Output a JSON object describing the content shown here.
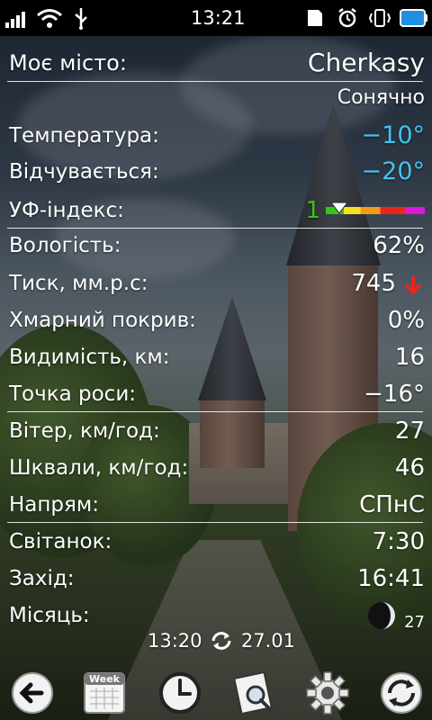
{
  "status_bar": {
    "time": "13:21",
    "icons": [
      "signal-icon",
      "wifi-icon",
      "usb-icon",
      "sd-card-icon",
      "alarm-icon",
      "vibrate-icon",
      "battery-icon"
    ]
  },
  "weather": {
    "city_label": "Моє місто:",
    "city": "Cherkasy",
    "condition": "Сонячно",
    "rows": [
      {
        "label": "Температура:",
        "value": "−10°",
        "color": "blue"
      },
      {
        "label": "Відчувається:",
        "value": "−20°",
        "color": "blue"
      },
      {
        "label": "УФ-індекс:",
        "value": "1",
        "uv_level": 0.05
      },
      {
        "label": "Вологість:",
        "value": "62%"
      },
      {
        "label": "Тиск, мм.р.с:",
        "value": "745",
        "trend": "down"
      },
      {
        "label": "Хмарний покрив:",
        "value": "0%"
      },
      {
        "label": "Видимість, км:",
        "value": "16"
      },
      {
        "label": "Точка роси:",
        "value": "−16°"
      },
      {
        "label": "Вітер, км/год:",
        "value": "27"
      },
      {
        "label": "Шквали, км/год:",
        "value": "46"
      },
      {
        "label": "Напрям:",
        "value": "СПнС"
      },
      {
        "label": "Світанок:",
        "value": "7:30"
      },
      {
        "label": "Захід:",
        "value": "16:41"
      },
      {
        "label": "Місяць:",
        "value": "27"
      }
    ],
    "updated_time": "13:20",
    "updated_date": "27.01",
    "colors": {
      "blue": "#42c4ee",
      "uv_green": "#39c419",
      "trend_red": "#e8261e"
    }
  },
  "toolbar": {
    "week_label": "Week",
    "buttons": [
      "back-button",
      "week-calendar-button",
      "clock-button",
      "search-map-button",
      "settings-button",
      "refresh-button"
    ]
  }
}
